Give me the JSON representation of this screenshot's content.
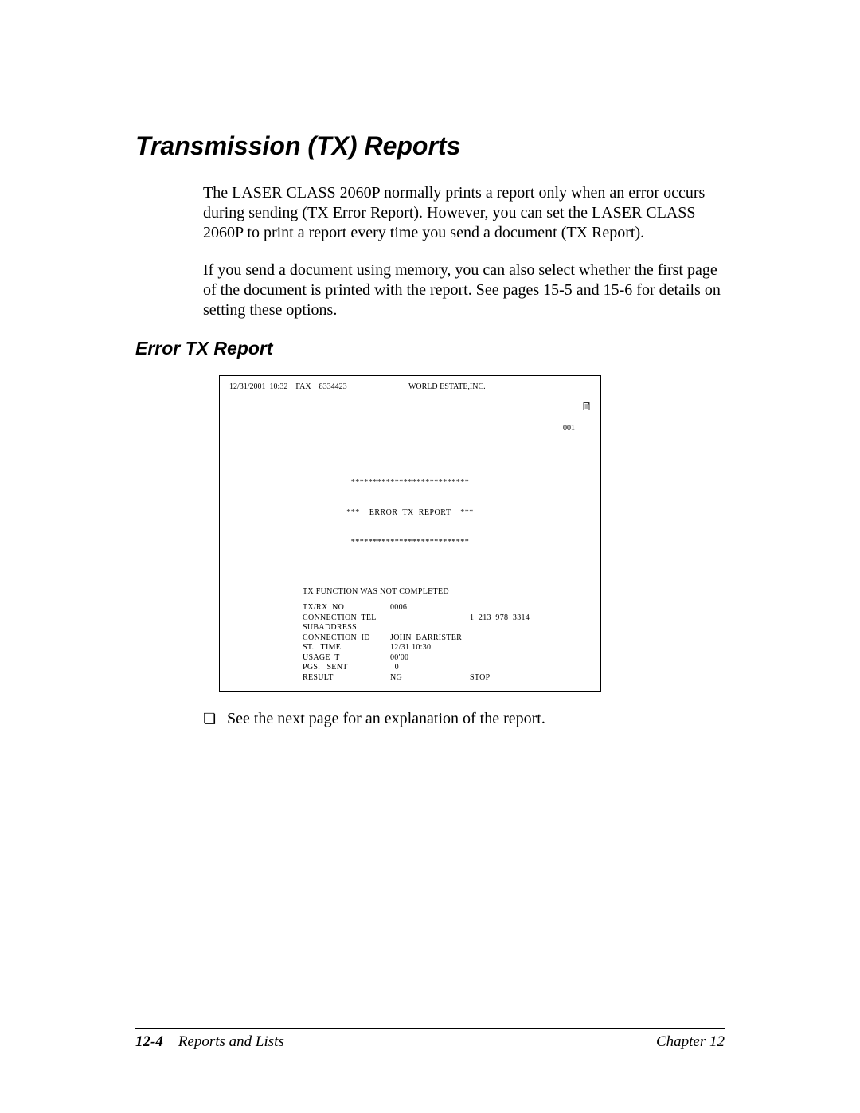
{
  "heading": "Transmission (TX) Reports",
  "para1": "The LASER CLASS 2060P normally prints a report only when an error occurs during sending (TX Error Report). However, you can set the LASER CLASS 2060P to print a report every time you send a document (TX Report).",
  "para2": "If you send a document using memory, you can also select whether the first page of the document is printed with the report. See pages 15-5 and 15-6 for details on setting these options.",
  "subheading": "Error TX Report",
  "report": {
    "header_left": "12/31/2001  10:32    FAX    8334423",
    "header_center": "WORLD ESTATE,INC.",
    "header_right": "001",
    "stars": "***************************",
    "title_line": "***    ERROR  TX  REPORT    ***",
    "msg": "TX FUNCTION WAS NOT COMPLETED",
    "rows": [
      {
        "label": "TX/RX  NO",
        "v1": "0006",
        "v2": ""
      },
      {
        "label": "CONNECTION  TEL",
        "v1": "",
        "v2": "1  213  978  3314"
      },
      {
        "label": "SUBADDRESS",
        "v1": "",
        "v2": ""
      },
      {
        "label": "CONNECTION  ID",
        "v1": "JOHN  BARRISTER",
        "v2": ""
      },
      {
        "label": "ST.   TIME",
        "v1": "12/31 10:30",
        "v2": ""
      },
      {
        "label": "USAGE  T",
        "v1": "00'00",
        "v2": ""
      },
      {
        "label": "PGS.   SENT",
        "v1": "  0",
        "v2": ""
      },
      {
        "label": "RESULT",
        "v1": "NG",
        "v2": "STOP"
      }
    ]
  },
  "note": "See the next page for an explanation of the report.",
  "footer": {
    "page_no": "12-4",
    "section": "Reports and Lists",
    "chapter": "Chapter 12"
  }
}
